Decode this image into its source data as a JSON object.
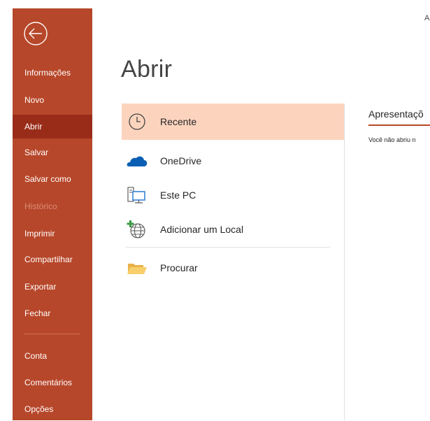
{
  "window": {
    "title_fragment": "A"
  },
  "sidebar": {
    "items": [
      {
        "label": "Informações"
      },
      {
        "label": "Novo"
      },
      {
        "label": "Abrir"
      },
      {
        "label": "Salvar"
      },
      {
        "label": "Salvar como"
      },
      {
        "label": "Histórico"
      },
      {
        "label": "Imprimir"
      },
      {
        "label": "Compartilhar"
      },
      {
        "label": "Exportar"
      },
      {
        "label": "Fechar"
      },
      {
        "label": "Conta"
      },
      {
        "label": "Comentários"
      },
      {
        "label": "Opções"
      }
    ],
    "active_item": "Abrir",
    "disabled_item": "Histórico"
  },
  "main": {
    "title": "Abrir",
    "locations": [
      {
        "label": "Recente",
        "icon": "clock-icon"
      },
      {
        "label": "OneDrive",
        "icon": "cloud-icon"
      },
      {
        "label": "Este PC",
        "icon": "computer-icon"
      },
      {
        "label": "Adicionar um Local",
        "icon": "add-globe-icon"
      },
      {
        "label": "Procurar",
        "icon": "folder-icon"
      }
    ]
  },
  "recent": {
    "heading": "Apresentaçõ",
    "empty_message": "Você não abriu n"
  },
  "colors": {
    "accent": "#b7472a",
    "active_nav": "#992c19",
    "selected_location": "#fcd4be"
  }
}
